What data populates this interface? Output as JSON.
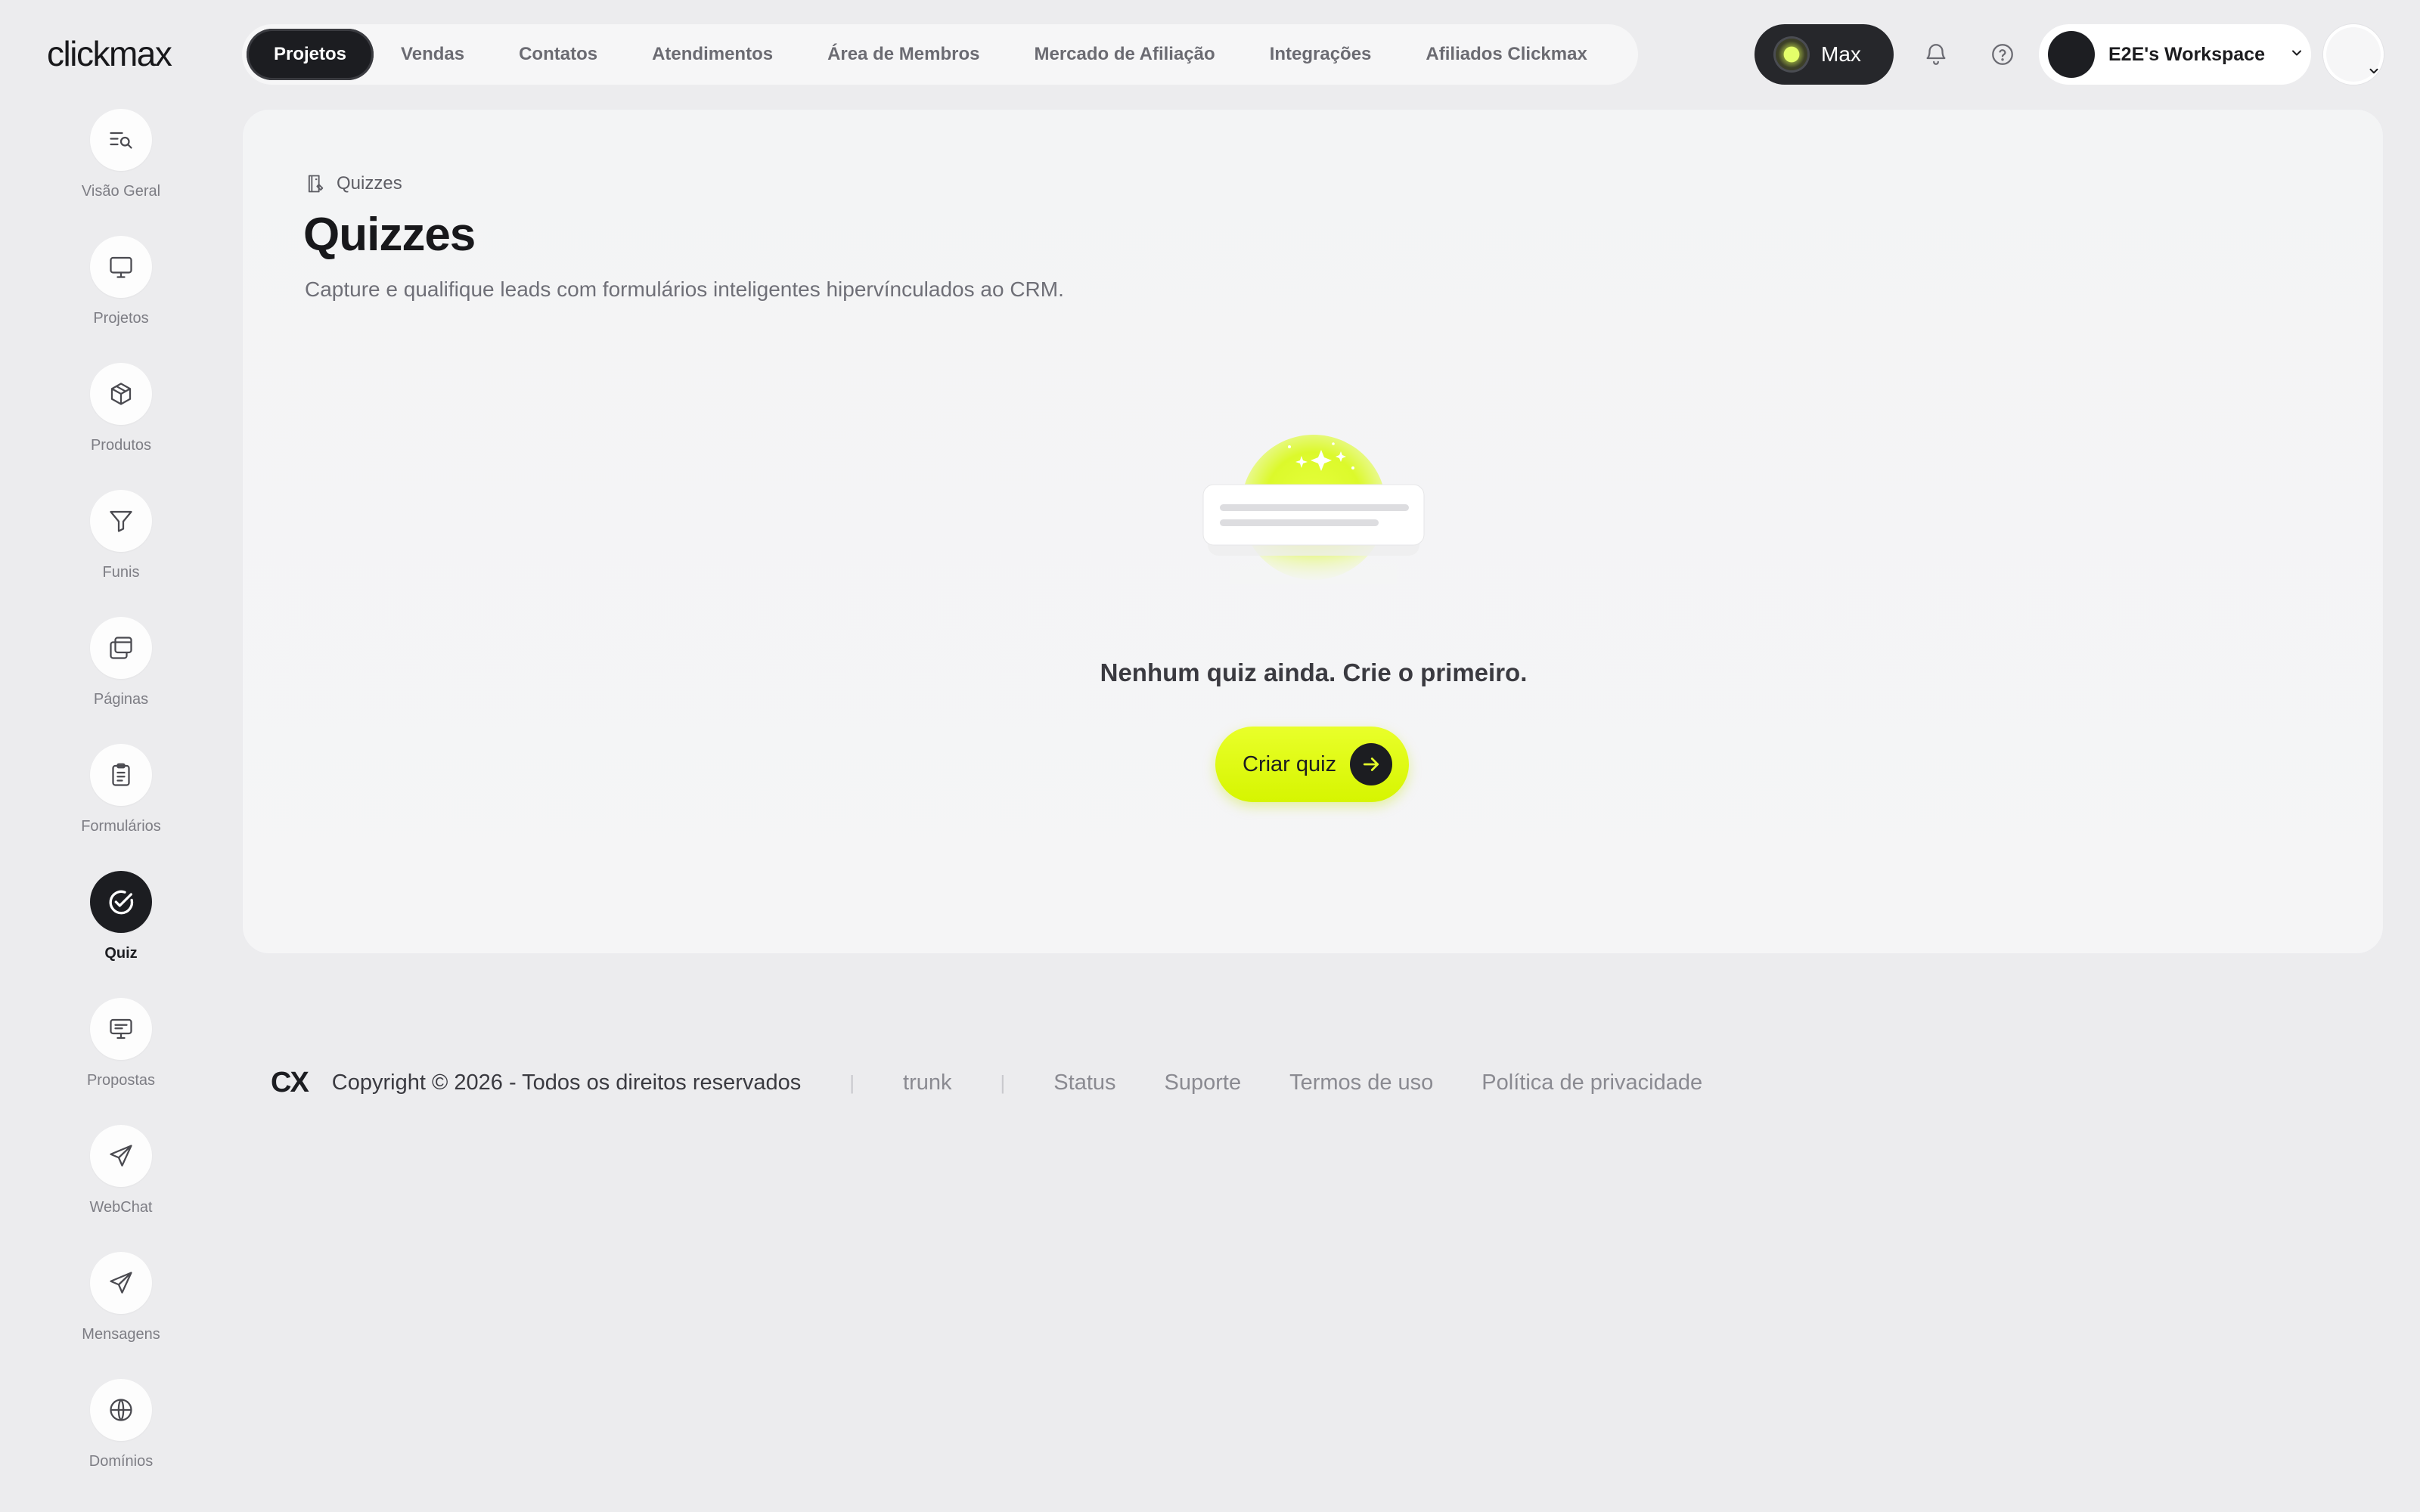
{
  "brand": {
    "logo": "clickmax"
  },
  "topnav": {
    "tabs": [
      {
        "label": "Projetos",
        "active": true
      },
      {
        "label": "Vendas"
      },
      {
        "label": "Contatos"
      },
      {
        "label": "Atendimentos"
      },
      {
        "label": "Área de Membros"
      },
      {
        "label": "Mercado de Afiliação"
      },
      {
        "label": "Integrações"
      },
      {
        "label": "Afiliados Clickmax"
      }
    ]
  },
  "header": {
    "max_label": "Max",
    "workspace_label": "E2E's Workspace",
    "icons": [
      "bell-icon",
      "help-icon",
      "chevron-down-icon"
    ]
  },
  "sidebar": {
    "items": [
      {
        "label": "Visão Geral",
        "icon": "overview-search-icon"
      },
      {
        "label": "Projetos",
        "icon": "monitor-icon"
      },
      {
        "label": "Produtos",
        "icon": "package-icon"
      },
      {
        "label": "Funis",
        "icon": "funnel-icon"
      },
      {
        "label": "Páginas",
        "icon": "pages-icon"
      },
      {
        "label": "Formulários",
        "icon": "clipboard-icon"
      },
      {
        "label": "Quiz",
        "icon": "check-circle-icon",
        "active": true
      },
      {
        "label": "Propostas",
        "icon": "presentation-icon"
      },
      {
        "label": "WebChat",
        "icon": "send-icon"
      },
      {
        "label": "Mensagens",
        "icon": "send-icon"
      },
      {
        "label": "Domínios",
        "icon": "globe-icon"
      }
    ]
  },
  "main": {
    "breadcrumb": "Quizzes",
    "title": "Quizzes",
    "subtitle": "Capture e qualifique leads com formulários inteligentes hipervínculados ao CRM.",
    "empty_state": "Nenhum quiz ainda. Crie o primeiro.",
    "create_button": "Criar quiz"
  },
  "footer": {
    "mark": "CX",
    "copyright": "Copyright © 2026 - Todos os direitos reservados",
    "separator": "|",
    "branch": "trunk",
    "links": [
      "Status",
      "Suporte",
      "Termos de uso",
      "Política de privacidade"
    ]
  },
  "colors": {
    "accent": "#dcf900",
    "dark": "#1c1d21",
    "background": "#ececee"
  }
}
